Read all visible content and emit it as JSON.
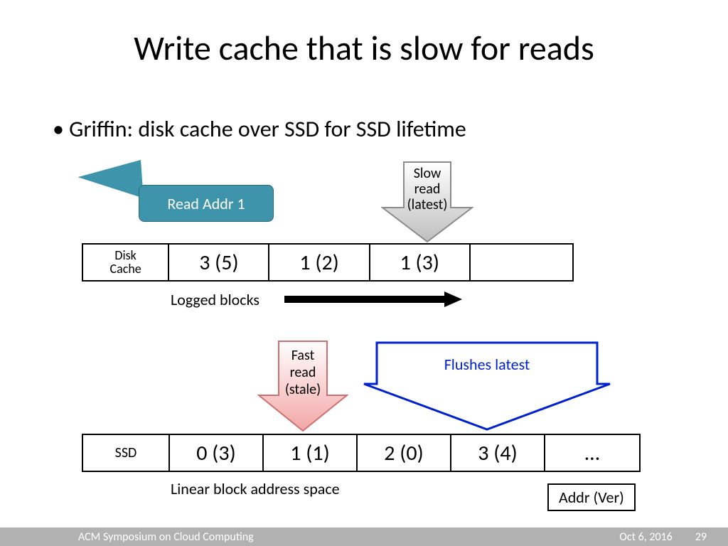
{
  "title": "Write cache that is slow for reads",
  "bullet": "Griffin: disk cache over SSD for SSD lifetime",
  "callout": "Read Addr 1",
  "slow_arrow": {
    "l1": "Slow",
    "l2": "read",
    "l3": "(latest)"
  },
  "fast_arrow": {
    "l1": "Fast",
    "l2": "read",
    "l3": "(stale)"
  },
  "flush_arrow": "Flushes latest",
  "disk": {
    "label_l1": "Disk",
    "label_l2": "Cache",
    "cells": [
      "3 (5)",
      "1 (2)",
      "1 (3)"
    ]
  },
  "logged_label": "Logged blocks",
  "ssd": {
    "label": "SSD",
    "cells": [
      "0 (3)",
      "1 (1)",
      "2 (0)",
      "3 (4)",
      "…"
    ]
  },
  "linear_label": "Linear block address space",
  "legend": "Addr (Ver)",
  "footer": {
    "left": "ACM Symposium on Cloud Computing",
    "date": "Oct 6, 2016",
    "page": "29"
  }
}
